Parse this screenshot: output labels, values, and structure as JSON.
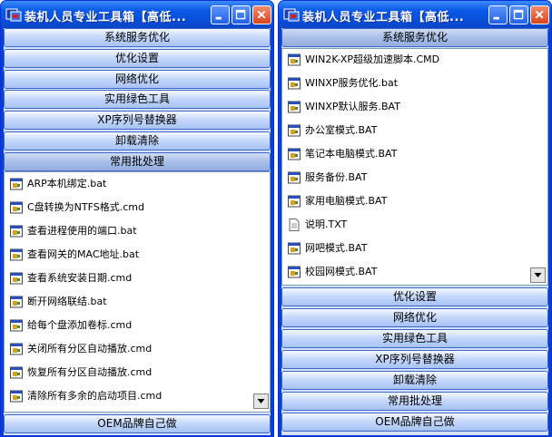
{
  "left": {
    "title": "装机人员专业工具箱【高低...",
    "categories_top": [
      "系统服务优化",
      "优化设置",
      "网络优化",
      "实用绿色工具",
      "XP序列号替换器",
      "卸载清除",
      "常用批处理"
    ],
    "items": [
      {
        "label": "ARP本机绑定.bat",
        "icon": "bat-file-icon"
      },
      {
        "label": "C盘转换为NTFS格式.cmd",
        "icon": "bat-file-icon"
      },
      {
        "label": "查看进程使用的端口.bat",
        "icon": "bat-file-icon"
      },
      {
        "label": "查看网关的MAC地址.bat",
        "icon": "bat-file-icon"
      },
      {
        "label": "查看系统安装日期.cmd",
        "icon": "bat-file-icon"
      },
      {
        "label": "断开网络联结.bat",
        "icon": "bat-file-icon"
      },
      {
        "label": "给每个盘添加卷标.cmd",
        "icon": "bat-file-icon"
      },
      {
        "label": "关闭所有分区自动播放.cmd",
        "icon": "bat-file-icon"
      },
      {
        "label": "恢复所有分区自动播放.cmd",
        "icon": "bat-file-icon"
      },
      {
        "label": "清除所有多余的启动项目.cmd",
        "icon": "bat-file-icon"
      }
    ],
    "categories_bottom": [
      "OEM品牌自己做"
    ]
  },
  "right": {
    "title": "装机人员专业工具箱【高低...",
    "categories_top": [
      "系统服务优化"
    ],
    "items": [
      {
        "label": "WIN2K-XP超级加速脚本.CMD",
        "icon": "bat-file-icon"
      },
      {
        "label": "WINXP服务优化.bat",
        "icon": "bat-file-icon"
      },
      {
        "label": "WINXP默认服务.BAT",
        "icon": "bat-file-icon"
      },
      {
        "label": "办公室模式.BAT",
        "icon": "bat-file-icon"
      },
      {
        "label": "笔记本电脑模式.BAT",
        "icon": "bat-file-icon"
      },
      {
        "label": "服务备份.BAT",
        "icon": "bat-file-icon"
      },
      {
        "label": "家用电脑模式.BAT",
        "icon": "bat-file-icon"
      },
      {
        "label": "说明.TXT",
        "icon": "text-file-icon"
      },
      {
        "label": "网吧模式.BAT",
        "icon": "bat-file-icon"
      },
      {
        "label": "校园网模式.BAT",
        "icon": "bat-file-icon"
      }
    ],
    "categories_bottom": [
      "优化设置",
      "网络优化",
      "实用绿色工具",
      "XP序列号替换器",
      "卸载清除",
      "常用批处理",
      "OEM品牌自己做"
    ]
  },
  "colors": {
    "titlebar": "#0a4fd8",
    "category": "#c7d9fb",
    "active_category": "#a9bfe8",
    "list_bg": "#ffffff"
  }
}
